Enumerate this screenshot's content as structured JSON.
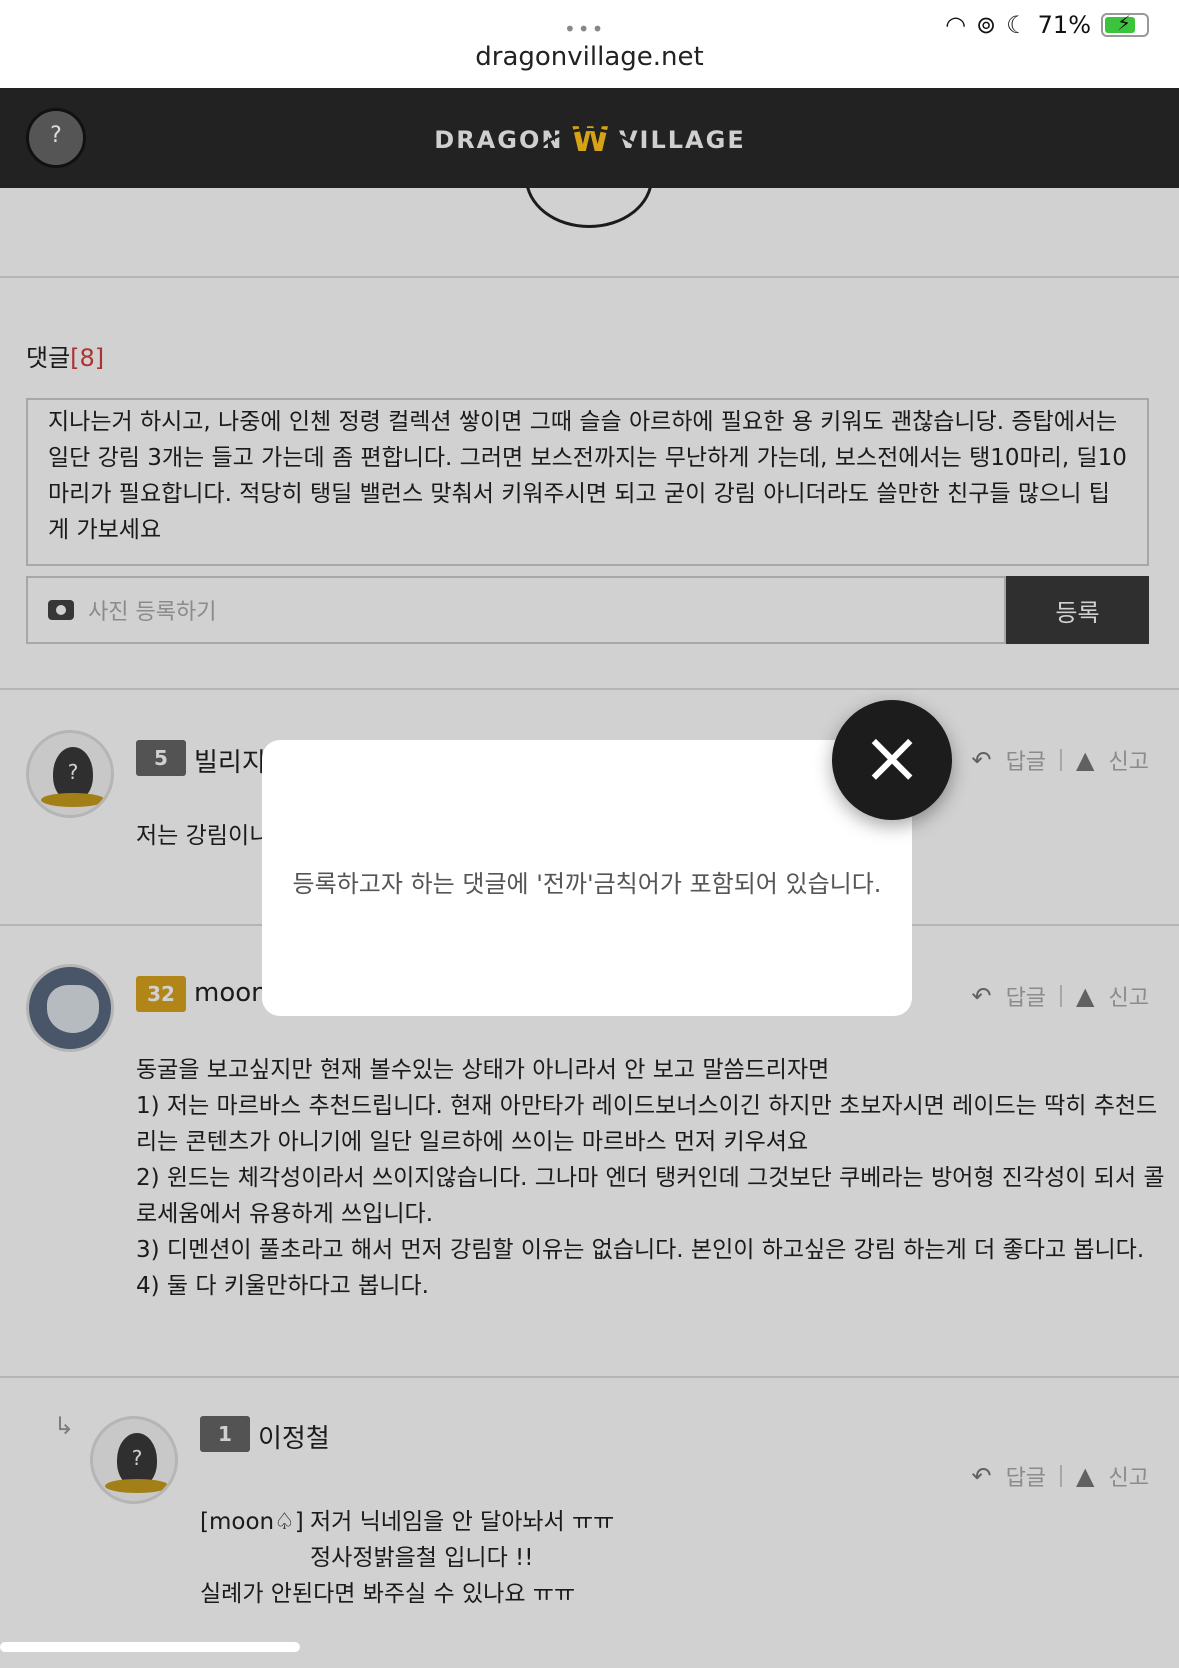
{
  "status_bar": {
    "dots": "•••",
    "url": "dragonvillage.net",
    "battery": "71%"
  },
  "header": {
    "logo_left": "DRAGON",
    "logo_right": "VILLAGE",
    "avatar_glyph": "?"
  },
  "comments": {
    "title": "댓글",
    "count": "[8]",
    "draft_text": "지나는거 하시고, 나중에 인첸 정령 컬렉션 쌓이면 그때 슬슬 아르하에 필요한 용 키워도 괜찮습니당. 증탑에서는 일단 강림 3개는 들고 가는데 좀 편합니다. 그러면 보스전까지는 무난하게 가는데, 보스전에서는 탱10마리, 딜10마리가 필요합니다. 적당히 탱딜 밸런스 맞춰서 키워주시면 되고 굳이 강림 아니더라도 쓸만한 친구들 많으니 팁게 가보세요",
    "photo_label": "사진 등록하기",
    "submit_label": "등록"
  },
  "actions": {
    "reply": "답글",
    "report": "신고"
  },
  "comment_list": [
    {
      "level": "5",
      "nickname": "빌리지",
      "text": "저는 강림이니"
    },
    {
      "level": "32",
      "nickname": "moon",
      "lines": [
        "동굴을 보고싶지만 현재 볼수있는 상태가 아니라서 안 보고 말씀드리자면",
        "1) 저는 마르바스 추천드립니다. 현재 아만타가 레이드보너스이긴 하지만 초보자시면 레이드는 딱히 추천드",
        "리는 콘텐츠가 아니기에 일단 일르하에 쓰이는 마르바스 먼저 키우셔요",
        "2) 윈드는 체각성이라서 쓰이지않습니다. 그나마 엔더 탱커인데 그것보단 쿠베라는 방어형 진각성이 되서 콜",
        "로세움에서 유용하게 쓰입니다.",
        "3) 디멘션이 풀초라고 해서 먼저 강림할 이유는 없습니다. 본인이 하고싶은 강림 하는게 더 좋다고 봅니다.",
        "4) 둘 다 키울만하다고 봅니다."
      ]
    },
    {
      "level": "1",
      "nickname": "이정철",
      "mention": "[moon♤]",
      "lines": [
        "저거 닉네임을 안 달아놔서 ㅠㅠ",
        "정사정밝을철 입니다 !!",
        "실례가 안된다면 봐주실 수 있나요 ㅠㅠ"
      ]
    }
  ],
  "modal": {
    "message": "등록하고자 하는 댓글에 '전까'금칙어가 포함되어 있습니다.",
    "close_glyph": "×"
  }
}
